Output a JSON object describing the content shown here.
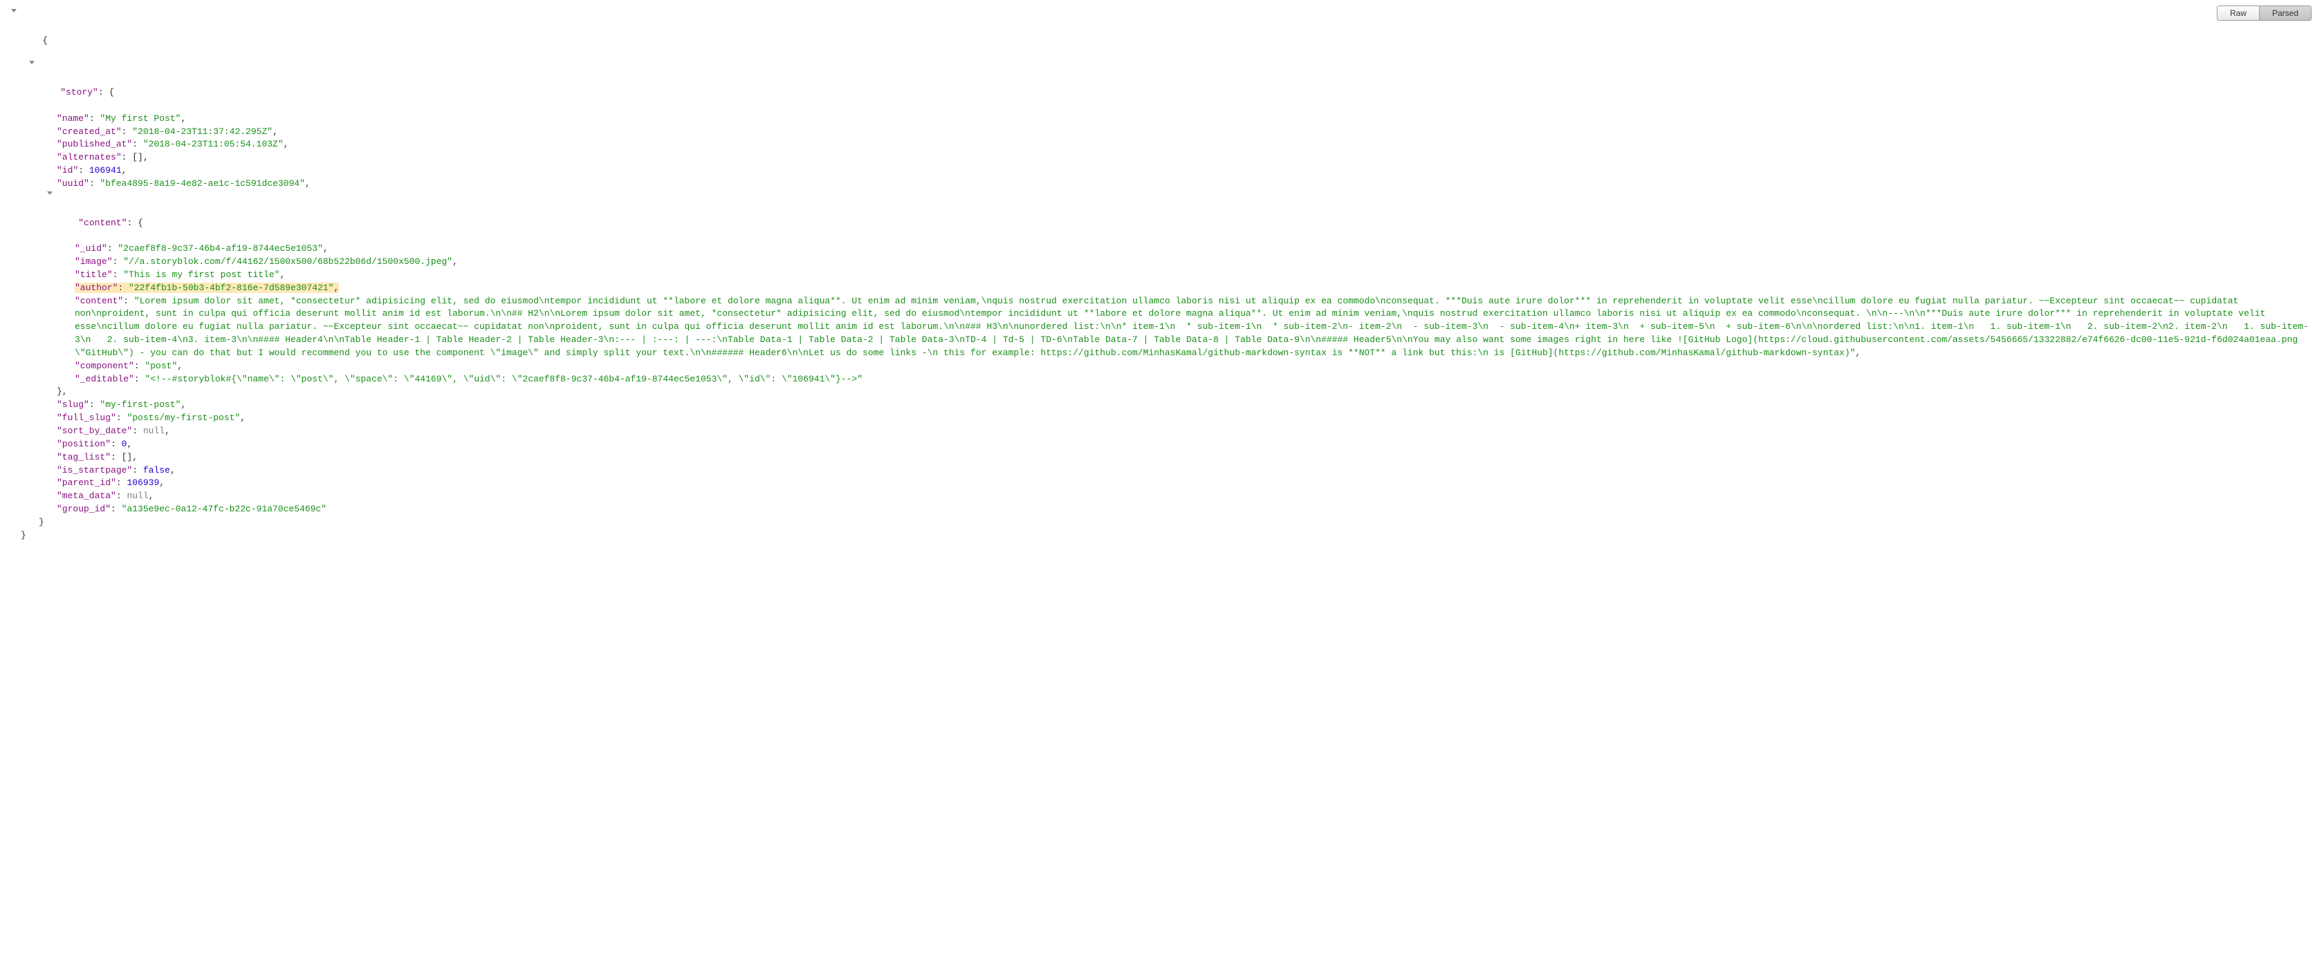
{
  "tabs": {
    "raw": "Raw",
    "parsed": "Parsed"
  },
  "json": {
    "open": "{",
    "close": "}",
    "story_key": "\"story\"",
    "story_open": ": {",
    "name_k": "\"name\"",
    "name_v": "\"My first Post\"",
    "created_k": "\"created_at\"",
    "created_v": "\"2018-04-23T11:37:42.295Z\"",
    "published_k": "\"published_at\"",
    "published_v": "\"2018-04-23T11:05:54.103Z\"",
    "alternates_k": "\"alternates\"",
    "alternates_v": "[]",
    "id_k": "\"id\"",
    "id_v": "106941",
    "uuid_k": "\"uuid\"",
    "uuid_v": "\"bfea4895-8a19-4e82-ae1c-1c591dce3094\"",
    "content_k": "\"content\"",
    "content_open": ": {",
    "uid_k": "\"_uid\"",
    "uid_v": "\"2caef8f8-9c37-46b4-af19-8744ec5e1053\"",
    "image_k": "\"image\"",
    "image_v": "\"//a.storyblok.com/f/44162/1500x500/68b522b06d/1500x500.jpeg\"",
    "title_k": "\"title\"",
    "title_v": "\"This is my first post title\"",
    "author_k": "\"author\"",
    "author_v": "\"22f4fb1b-50b3-4bf2-816e-7d589e307421\"",
    "innercontent_k": "\"content\"",
    "innercontent_v": "\"Lorem ipsum dolor sit amet, *consectetur* adipisicing elit, sed do eiusmod\\ntempor incididunt ut **labore et dolore magna aliqua**. Ut enim ad minim veniam,\\nquis nostrud exercitation ullamco laboris nisi ut aliquip ex ea commodo\\nconsequat. ***Duis aute irure dolor*** in reprehenderit in voluptate velit esse\\ncillum dolore eu fugiat nulla pariatur. ~~Excepteur sint occaecat~~ cupidatat non\\nproident, sunt in culpa qui officia deserunt mollit anim id est laborum.\\n\\n## H2\\n\\nLorem ipsum dolor sit amet, *consectetur* adipisicing elit, sed do eiusmod\\ntempor incididunt ut **labore et dolore magna aliqua**. Ut enim ad minim veniam,\\nquis nostrud exercitation ullamco laboris nisi ut aliquip ex ea commodo\\nconsequat. \\n\\n---\\n\\n***Duis aute irure dolor*** in reprehenderit in voluptate velit esse\\ncillum dolore eu fugiat nulla pariatur. ~~Excepteur sint occaecat~~ cupidatat non\\nproident, sunt in culpa qui officia deserunt mollit anim id est laborum.\\n\\n### H3\\n\\nunordered list:\\n\\n* item-1\\n  * sub-item-1\\n  * sub-item-2\\n- item-2\\n  - sub-item-3\\n  - sub-item-4\\n+ item-3\\n  + sub-item-5\\n  + sub-item-6\\n\\n\\nordered list:\\n\\n1. item-1\\n   1. sub-item-1\\n   2. sub-item-2\\n2. item-2\\n   1. sub-item-3\\n   2. sub-item-4\\n3. item-3\\n\\n#### Header4\\n\\nTable Header-1 | Table Header-2 | Table Header-3\\n:--- | :---: | ---:\\nTable Data-1 | Table Data-2 | Table Data-3\\nTD-4 | Td-5 | TD-6\\nTable Data-7 | Table Data-8 | Table Data-9\\n\\n##### Header5\\n\\nYou may also want some images right in here like ![GitHub Logo](https://cloud.githubusercontent.com/assets/5456665/13322882/e74f6626-dc00-11e5-921d-f6d024a01eaa.png \\\"GitHub\\\") - you can do that but I would recommend you to use the component \\\"image\\\" and simply split your text.\\n\\n###### Header6\\n\\nLet us do some links -\\n this for example: https://github.com/MinhasKamal/github-markdown-syntax is **NOT** a link but this:\\n is [GitHub](https://github.com/MinhasKamal/github-markdown-syntax)\"",
    "component_k": "\"component\"",
    "component_v": "\"post\"",
    "editable_k": "\"_editable\"",
    "editable_v": "\"<!--#storyblok#{\\\"name\\\": \\\"post\\\", \\\"space\\\": \\\"44169\\\", \\\"uid\\\": \\\"2caef8f8-9c37-46b4-af19-8744ec5e1053\\\", \\\"id\\\": \\\"106941\\\"}-->\"",
    "content_close": "},",
    "slug_k": "\"slug\"",
    "slug_v": "\"my-first-post\"",
    "fullslug_k": "\"full_slug\"",
    "fullslug_v": "\"posts/my-first-post\"",
    "sortbydate_k": "\"sort_by_date\"",
    "sortbydate_v": "null",
    "position_k": "\"position\"",
    "position_v": "0",
    "taglist_k": "\"tag_list\"",
    "taglist_v": "[]",
    "isstart_k": "\"is_startpage\"",
    "isstart_v": "false",
    "parentid_k": "\"parent_id\"",
    "parentid_v": "106939",
    "metadata_k": "\"meta_data\"",
    "metadata_v": "null",
    "groupid_k": "\"group_id\"",
    "groupid_v": "\"a135e9ec-0a12-47fc-b22c-91a70ce5469c\"",
    "story_close": "}",
    "colon": ": ",
    "comma": ","
  }
}
